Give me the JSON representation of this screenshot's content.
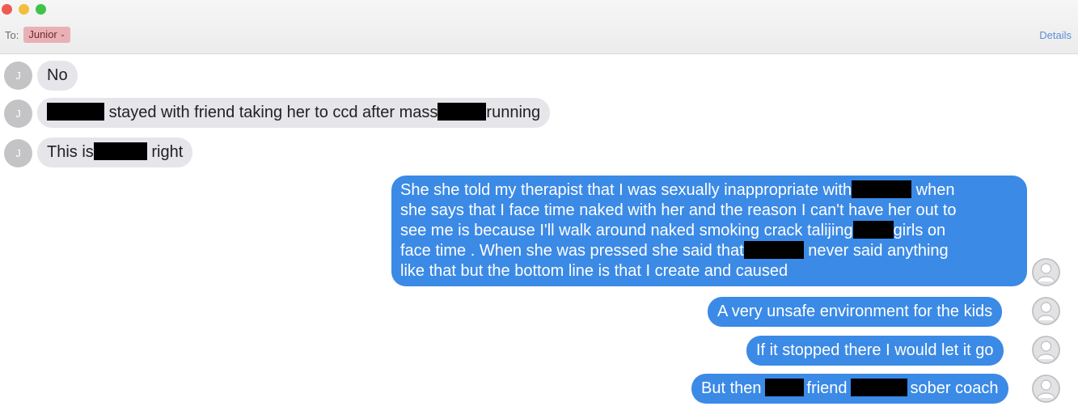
{
  "header": {
    "to_label": "To:",
    "recipient": "Junior",
    "details_label": "Details"
  },
  "contact_initial": "J",
  "messages_in": [
    {
      "parts": [
        "No"
      ]
    },
    {
      "parts": [
        "stayed with friend taking her to ccd after mass",
        "running"
      ]
    },
    {
      "parts": [
        "This is",
        "right"
      ]
    }
  ],
  "messages_out": [
    {
      "lines": [
        [
          "She she told my therapist that I was sexually inappropriate with",
          "when"
        ],
        [
          "she says that I face time naked with her and the reason I can't have her out to"
        ],
        [
          "see me is because I'll walk around naked smoking crack talijing",
          "girls on"
        ],
        [
          "face time . When she was pressed she said that",
          "never said anything"
        ],
        [
          "like that but the bottom line is that I create and caused"
        ]
      ]
    },
    {
      "parts": [
        "A very unsafe environment for the kids"
      ]
    },
    {
      "parts": [
        "If it stopped there I would let it go"
      ]
    },
    {
      "parts": [
        "But then",
        "friend",
        "sober coach"
      ]
    }
  ],
  "colors": {
    "incoming_bubble": "#e5e5ea",
    "outgoing_bubble": "#3b8ae6",
    "recipient_chip": "#e9b1b5",
    "details_link": "#5b8fd6"
  },
  "icons": [
    "close-dot",
    "minimize-dot",
    "maximize-dot",
    "chevron-down-icon",
    "contact-avatar",
    "user-silhouette-icon"
  ]
}
